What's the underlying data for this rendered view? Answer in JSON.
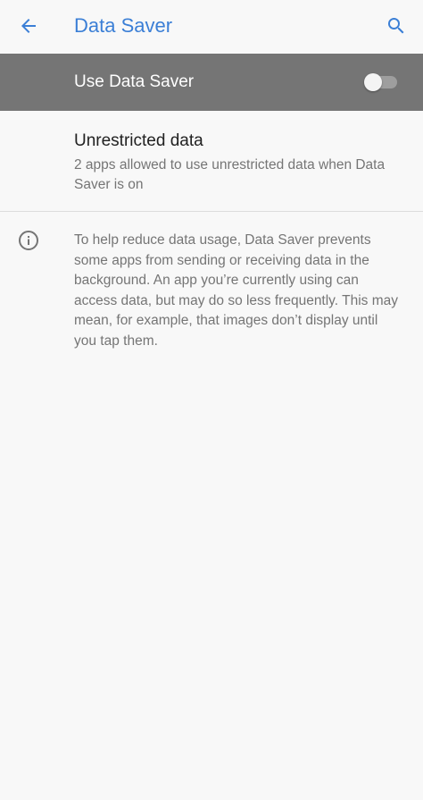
{
  "app_bar": {
    "back_icon": "arrow-back-icon",
    "title": "Data Saver",
    "search_icon": "search-icon",
    "accent_color": "#3b7fd6"
  },
  "master_switch": {
    "label": "Use Data Saver",
    "enabled": false,
    "background_color": "#757575"
  },
  "unrestricted": {
    "title": "Unrestricted data",
    "summary": "2 apps allowed to use unrestricted data when Data Saver is on"
  },
  "footer": {
    "info_icon": "info-icon",
    "text": "To help reduce data usage, Data Saver prevents some apps from sending or receiving data in the background. An app you’re currently using can access data, but may do so less frequently. This may mean, for example, that images don’t display until you tap them."
  }
}
